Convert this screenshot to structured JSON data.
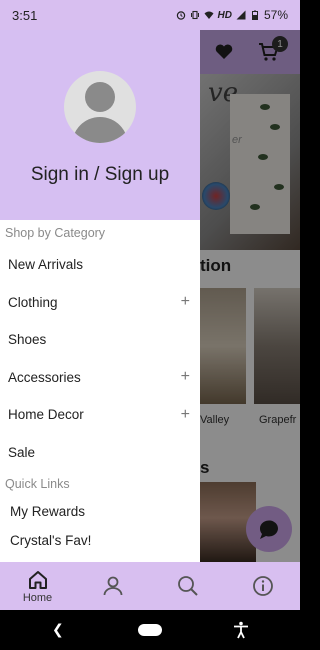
{
  "status_bar": {
    "time": "3:51",
    "network_label": "HD",
    "battery": "57%"
  },
  "background_page": {
    "hero_text": "ve",
    "hero_subtext": "er",
    "collection_title": "tion",
    "products": [
      {
        "name": "Valley"
      },
      {
        "name": "Grapefr"
      }
    ],
    "section_title": "s",
    "cart_count": "1"
  },
  "drawer": {
    "sign_in_label": "Sign in / Sign up",
    "shop_section_label": "Shop by Category",
    "categories": [
      {
        "label": "New Arrivals",
        "expandable": false
      },
      {
        "label": "Clothing",
        "expandable": true
      },
      {
        "label": "Shoes",
        "expandable": false
      },
      {
        "label": "Accessories",
        "expandable": true
      },
      {
        "label": "Home Decor",
        "expandable": true
      },
      {
        "label": "Sale",
        "expandable": false
      }
    ],
    "expand_glyph": "+",
    "quick_links_label": "Quick Links",
    "quick_links": [
      {
        "label": "My Rewards"
      },
      {
        "label": "Crystal's Fav!"
      }
    ]
  },
  "bottom_nav": {
    "items": [
      {
        "label": "Home",
        "icon": "home-icon",
        "active": true
      },
      {
        "label": "",
        "icon": "account-icon",
        "active": false
      },
      {
        "label": "",
        "icon": "search-icon",
        "active": false
      },
      {
        "label": "",
        "icon": "info-icon",
        "active": false
      }
    ]
  },
  "colors": {
    "accent": "#d6bff2",
    "nav_bar": "#d8bff0"
  }
}
